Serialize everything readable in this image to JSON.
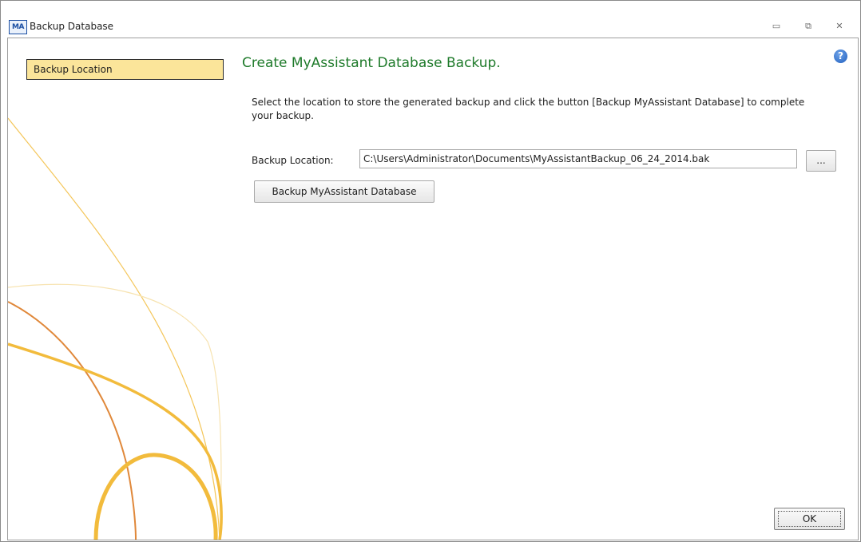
{
  "window": {
    "title": "Backup Database",
    "app_icon_text": "MA",
    "controls": {
      "minimize": "▭",
      "maximize": "⧉",
      "close": "✕"
    }
  },
  "sidebar": {
    "items": [
      {
        "label": "Backup Location",
        "selected": true
      }
    ]
  },
  "main": {
    "heading": "Create MyAssistant Database Backup.",
    "help_icon": "help-icon",
    "description": "Select the location to store the generated backup and click the button [Backup MyAssistant Database] to complete your backup.",
    "backup_location_label": "Backup Location:",
    "backup_location_value": "C:\\Users\\Administrator\\Documents\\MyAssistantBackup_06_24_2014.bak",
    "browse_label": "...",
    "backup_button_label": "Backup MyAssistant Database"
  },
  "footer": {
    "ok_label": "OK"
  },
  "colors": {
    "heading": "#1e7a2a",
    "nav_selected_bg": "#fbe59a",
    "deco_gold": "#f2bb3c",
    "deco_orange": "#e0883a"
  }
}
